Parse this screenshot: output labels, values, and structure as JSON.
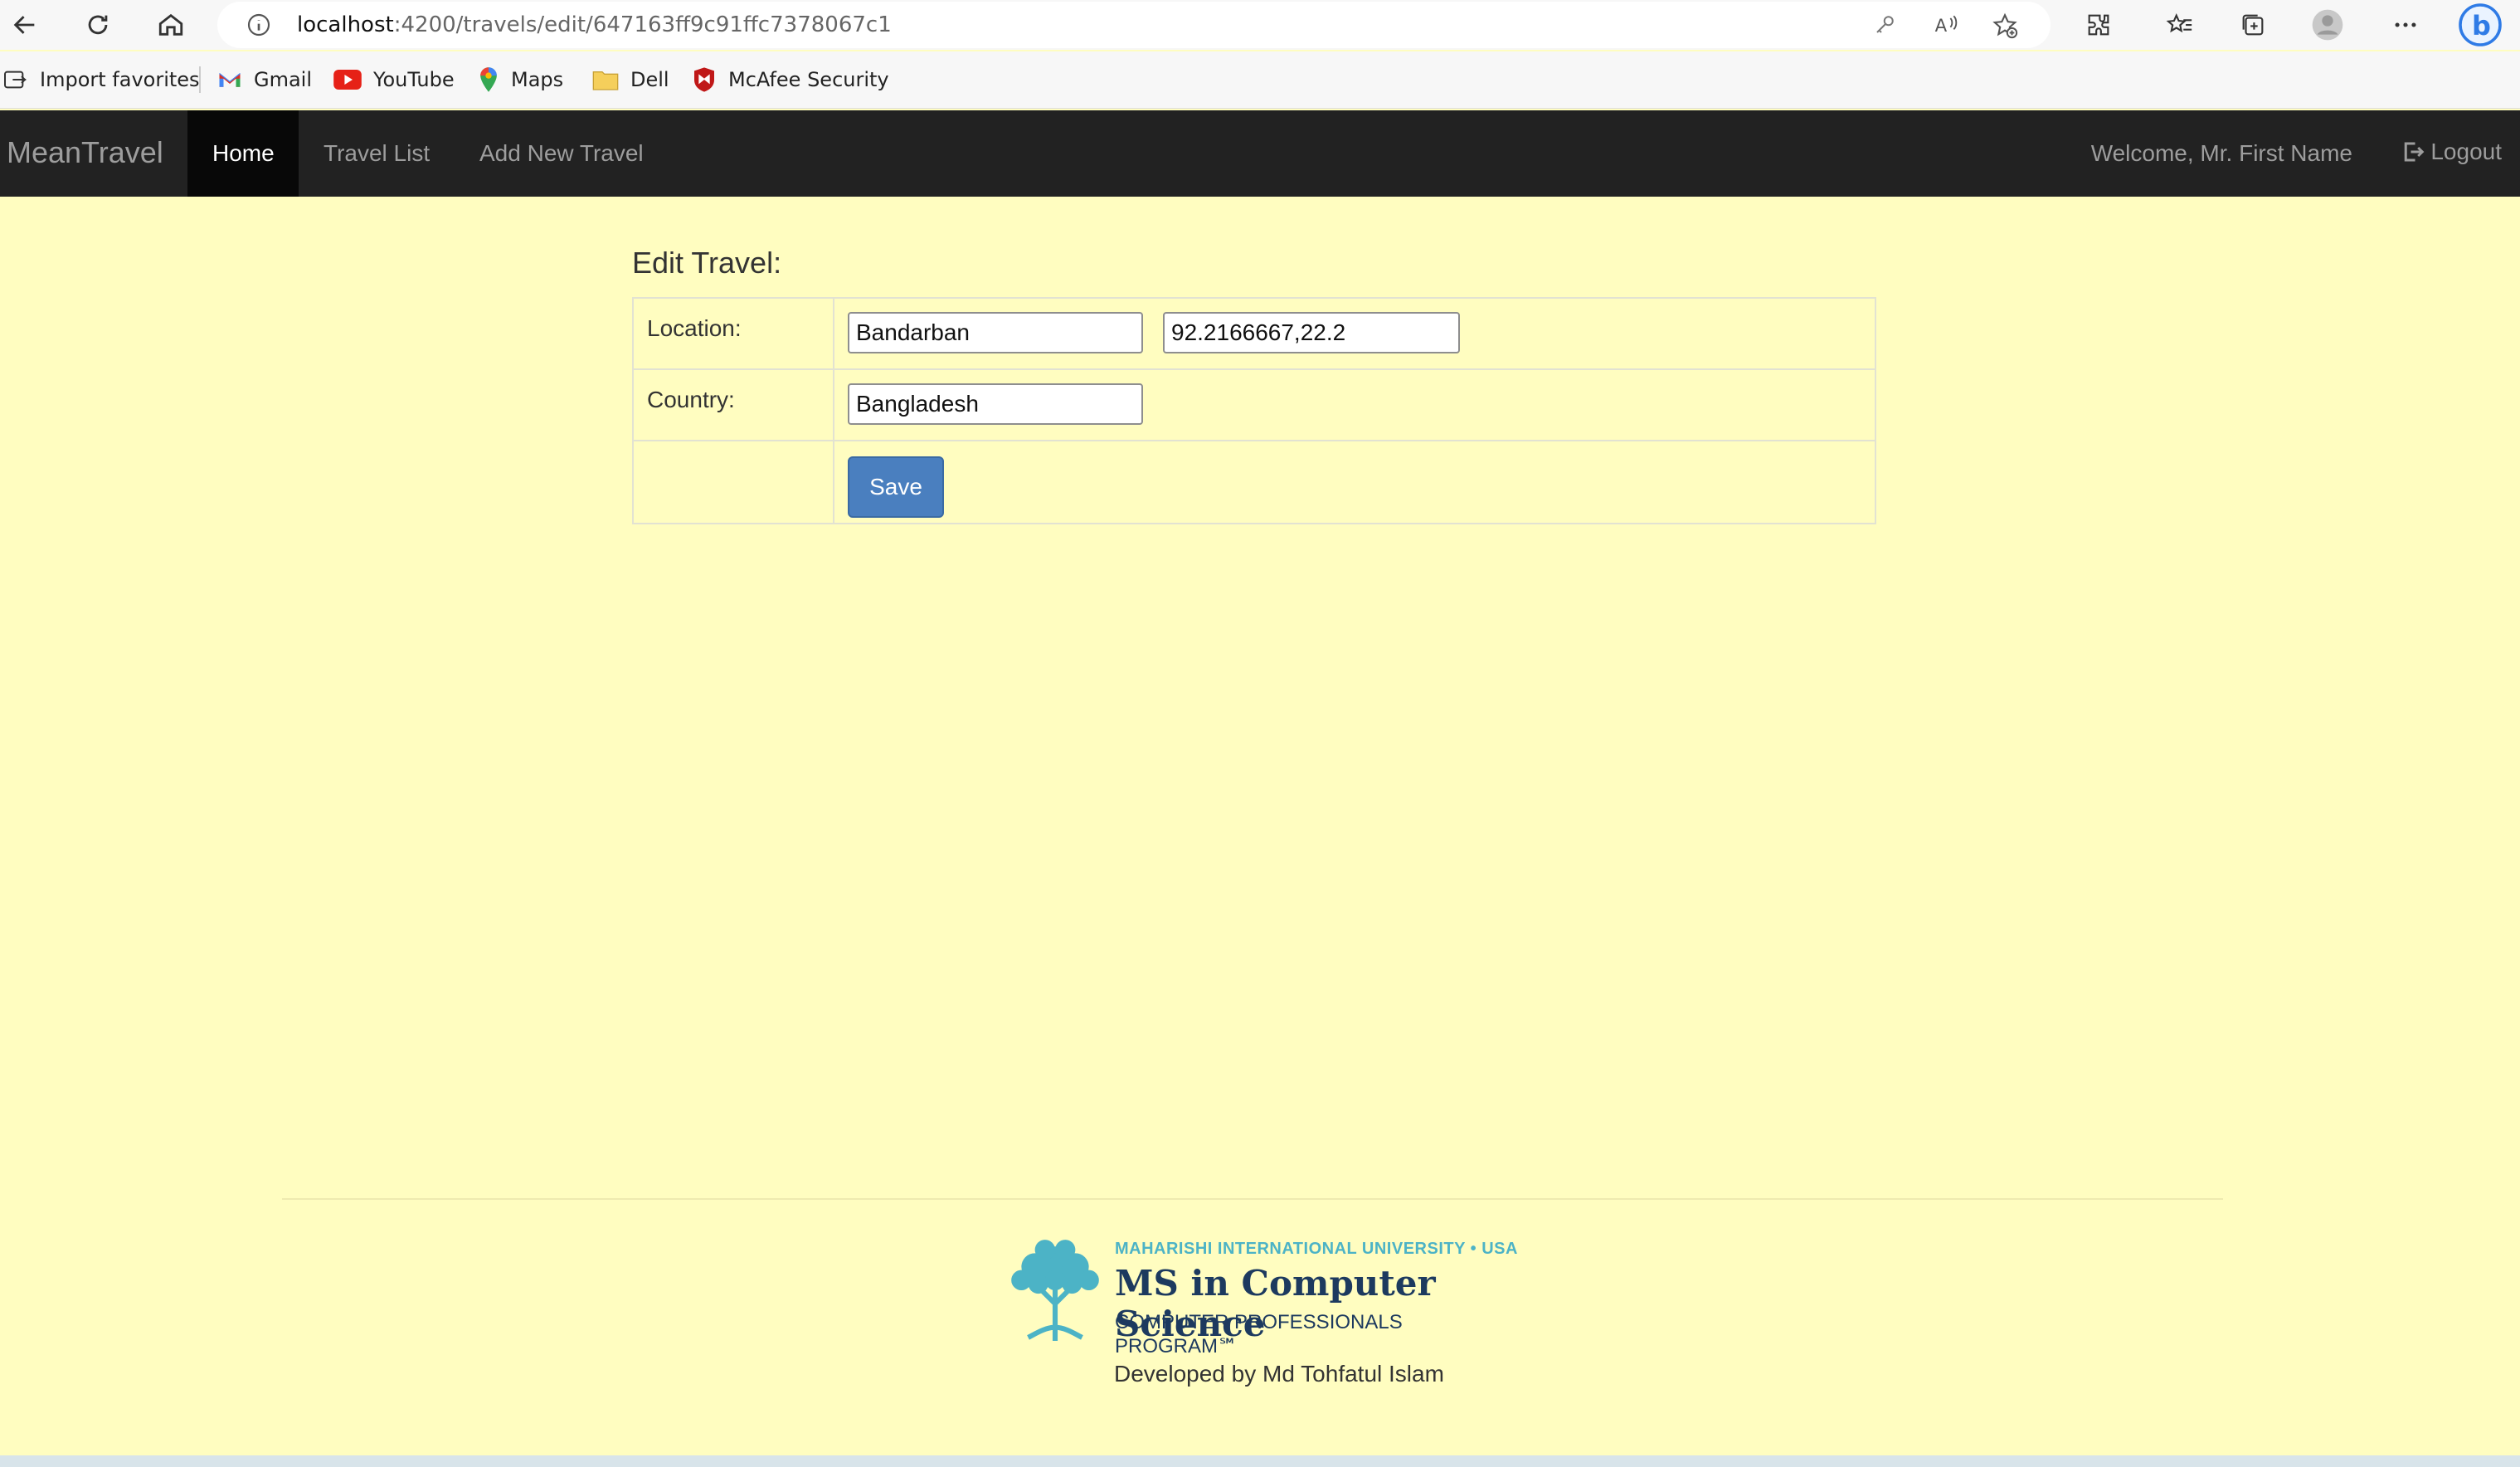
{
  "browser": {
    "url_host": "localhost",
    "url_path": ":4200/travels/edit/647163ff9c91ffc7378067c1",
    "bookmarks": [
      {
        "label": "Import favorites",
        "icon": "import-icon"
      },
      {
        "label": "Gmail",
        "icon": "gmail-icon"
      },
      {
        "label": "YouTube",
        "icon": "youtube-icon"
      },
      {
        "label": "Maps",
        "icon": "maps-icon"
      },
      {
        "label": "Dell",
        "icon": "folder-icon"
      },
      {
        "label": "McAfee Security",
        "icon": "mcafee-icon"
      }
    ]
  },
  "navbar": {
    "brand": "MeanTravel",
    "items": [
      {
        "label": "Home",
        "active": true
      },
      {
        "label": "Travel List",
        "active": false
      },
      {
        "label": "Add New Travel",
        "active": false
      }
    ],
    "welcome": "Welcome, Mr. First Name",
    "logout": "Logout"
  },
  "form": {
    "heading": "Edit Travel:",
    "location_label": "Location:",
    "location_value": "Bandarban",
    "coordinates_value": "92.2166667,22.2",
    "country_label": "Country:",
    "country_value": "Bangladesh",
    "save_label": "Save"
  },
  "footer": {
    "logo_top": "MAHARISHI INTERNATIONAL UNIVERSITY • USA",
    "logo_mid": "MS in Computer Science",
    "logo_bot": "COMPUTER PROFESSIONALS PROGRAM℠",
    "credit": "Developed by Md Tohfatul Islam"
  },
  "colors": {
    "page_bg": "#fffdc0",
    "navbar_bg": "#222222",
    "button_blue": "#4a7fbf",
    "logo_teal": "#4cb3c6"
  }
}
